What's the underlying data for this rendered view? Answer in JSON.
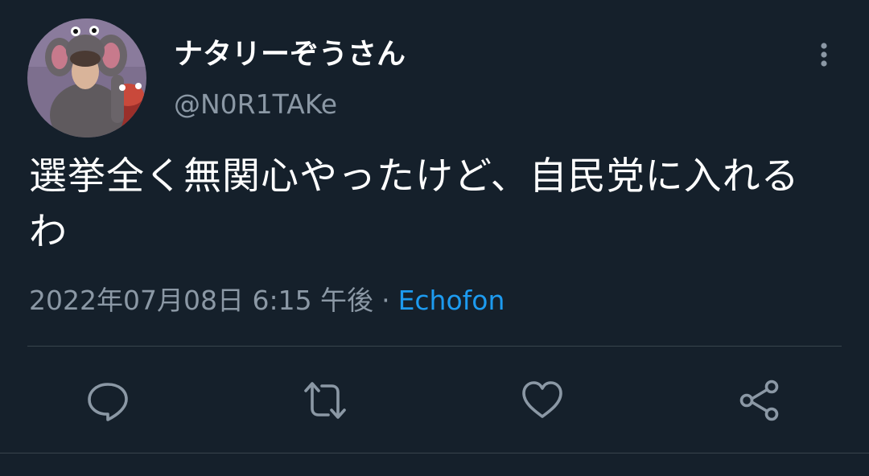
{
  "tweet": {
    "author": {
      "display_name": "ナタリーぞうさん",
      "handle": "@N0R1TAKe"
    },
    "text": "選挙全く無関心やったけど、自民党に入れるわ",
    "timestamp": "2022年07月08日 6:15 午後",
    "separator": "·",
    "source": "Echofon"
  },
  "actions": {
    "reply": "reply-icon",
    "retweet": "retweet-icon",
    "like": "heart-icon",
    "share": "share-icon"
  },
  "colors": {
    "background": "#15202b",
    "text_primary": "#ffffff",
    "text_secondary": "#8b98a5",
    "accent": "#1d9bf0",
    "divider": "#38444d"
  }
}
